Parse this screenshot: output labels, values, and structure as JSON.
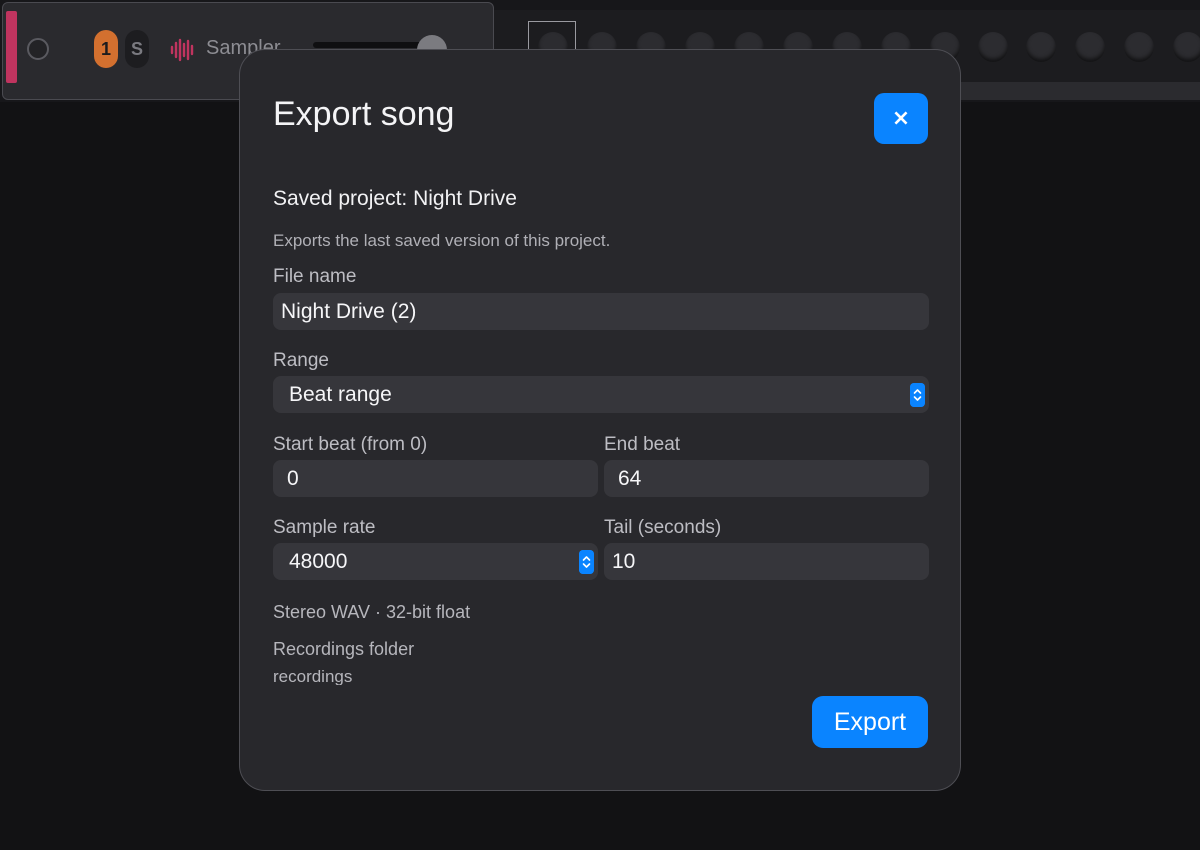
{
  "track": {
    "number": "1",
    "solo_label": "S",
    "instrument_name": "Sampler",
    "color": "#c0345f",
    "icon": "waveform-icon"
  },
  "dialog": {
    "title": "Export song",
    "close_label": "×",
    "project_line": "Saved project: Night Drive",
    "hint": "Exports the last saved version of this project.",
    "file_name": {
      "label": "File name",
      "value": "Night Drive (2)"
    },
    "range": {
      "label": "Range",
      "selected": "Beat range"
    },
    "start_beat": {
      "label": "Start beat (from 0)",
      "value": "0"
    },
    "end_beat": {
      "label": "End beat",
      "value": "64"
    },
    "sample_rate": {
      "label": "Sample rate",
      "selected": "48000"
    },
    "tail": {
      "label": "Tail (seconds)",
      "value": "10"
    },
    "format_info": "Stereo WAV · 32-bit float",
    "folder_label": "Recordings folder",
    "folder_value": "recordings",
    "export_label": "Export",
    "accent_color": "#0a84ff"
  }
}
